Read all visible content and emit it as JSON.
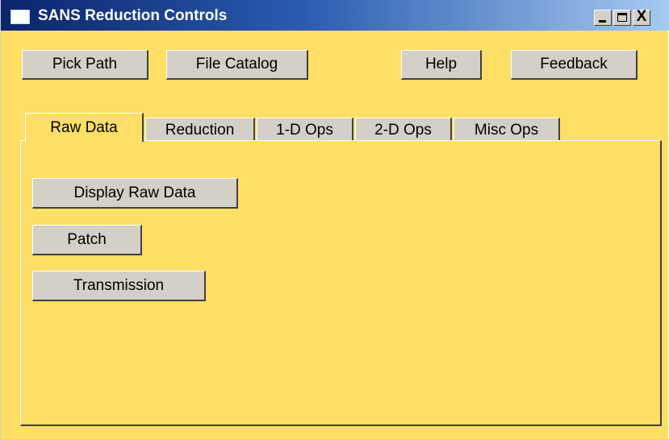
{
  "window": {
    "title": "SANS Reduction Controls",
    "controls": {
      "close_glyph": "X"
    }
  },
  "toolbar": {
    "pick_path": "Pick Path",
    "file_catalog": "File Catalog",
    "help": "Help",
    "feedback": "Feedback"
  },
  "tabs": [
    {
      "label": "Raw Data",
      "active": true
    },
    {
      "label": "Reduction",
      "active": false
    },
    {
      "label": "1-D Ops",
      "active": false
    },
    {
      "label": "2-D Ops",
      "active": false
    },
    {
      "label": "Misc Ops",
      "active": false
    }
  ],
  "raw_data_panel": {
    "display_raw_data": "Display Raw Data",
    "patch": "Patch",
    "transmission": "Transmission"
  },
  "colors": {
    "panel_background": "#ffdf66",
    "button_face": "#d4d0c8",
    "titlebar_start": "#0a246a",
    "titlebar_end": "#a6caf0"
  }
}
